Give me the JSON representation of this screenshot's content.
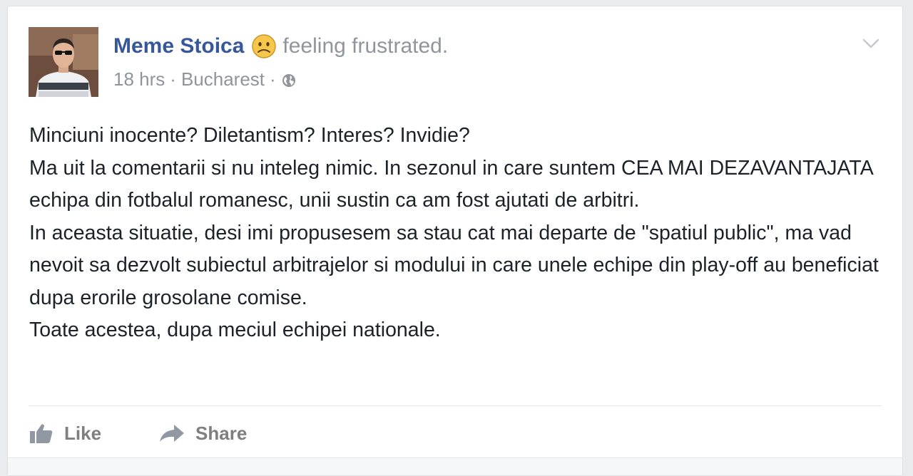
{
  "post": {
    "author": "Meme Stoica",
    "feeling_icon": "frustrated-face-emoji",
    "feeling": "feeling frustrated.",
    "time": "18 hrs",
    "separator": "·",
    "location": "Bucharest",
    "privacy_icon": "globe-icon",
    "menu_icon": "chevron-down-icon",
    "avatar_icon": "profile-photo",
    "paragraphs": [
      "Minciuni inocente? Diletantism? Interes? Invidie?",
      "Ma uit la comentarii si nu inteleg nimic. In sezonul in care suntem CEA MAI DEZAVANTAJATA echipa din fotbalul romanesc, unii sustin ca am fost ajutati de arbitri.",
      "In aceasta situatie, desi imi propusesem sa stau cat mai departe de \"spatiul public\", ma vad nevoit sa dezvolt subiectul arbitrajelor si modului in care unele echipe din play-off au beneficiat dupa erorile grosolane comise.",
      "Toate acestea, dupa meciul echipei nationale."
    ]
  },
  "actions": {
    "like_label": "Like",
    "like_icon": "thumbs-up-icon",
    "share_label": "Share",
    "share_icon": "share-arrow-icon"
  },
  "colors": {
    "author_link": "#365899",
    "meta_text": "#90949c",
    "body_text": "#1d2129",
    "background": "#e9ebee",
    "action_text": "#7f7f7f"
  }
}
